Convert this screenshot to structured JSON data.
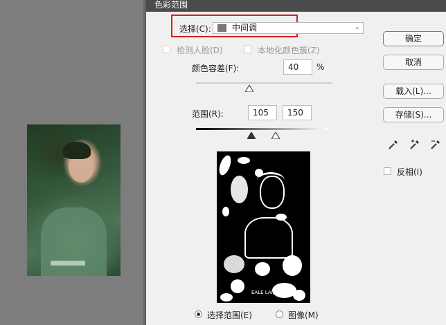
{
  "dialog": {
    "title": "色彩范围",
    "select_label": "选择(C):",
    "select_value": "中间调",
    "select_swatch_color": "#777777",
    "detect_faces_label": "检测人脸(D)",
    "localized_clusters_label": "本地化颜色簇(Z)",
    "fuzziness_label": "颜色容差(F):",
    "fuzziness_value": "40",
    "fuzziness_unit": "%",
    "range_label": "范围(R):",
    "range_low": "105",
    "range_high": "150",
    "radio_selection_label": "选择范围(E)",
    "radio_image_label": "图像(M)",
    "radio_selected": "selection",
    "invert_label": "反相(I)",
    "preview_watermark": "EALE LAIE"
  },
  "buttons": {
    "ok": "确定",
    "cancel": "取消",
    "load": "载入(L)...",
    "save": "存储(S)..."
  },
  "eyedroppers": [
    "eyedropper-icon",
    "eyedropper-plus-icon",
    "eyedropper-minus-icon"
  ],
  "canvas": {
    "watermark": "EALE LAIE",
    "background_color": "#7d7d7d"
  },
  "colors": {
    "highlight": "#d21f1f",
    "titlebar": "#4b4b4b",
    "dialog_bg": "#f0f0f0"
  }
}
